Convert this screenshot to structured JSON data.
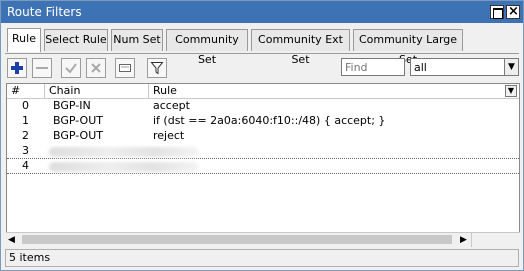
{
  "window": {
    "title": "Route Filters",
    "colors": {
      "titlebar": "#3d73b5",
      "add_icon": "#1a3fa8"
    }
  },
  "tabs": [
    {
      "label": "Rule",
      "active": true
    },
    {
      "label": "Select Rule"
    },
    {
      "label": "Num Set"
    },
    {
      "label": "Community Set"
    },
    {
      "label": "Community Ext Set"
    },
    {
      "label": "Community Large Set"
    }
  ],
  "toolbar": {
    "icons": [
      "add-icon",
      "remove-icon",
      "enable-icon",
      "disable-icon",
      "comment-icon",
      "filter-icon"
    ],
    "find_placeholder": "Find",
    "filter_select_value": "all"
  },
  "table": {
    "columns": [
      "#",
      "Chain",
      "Rule"
    ],
    "rows": [
      {
        "num": "0",
        "chain": "BGP-IN",
        "rule": "accept"
      },
      {
        "num": "1",
        "chain": "BGP-OUT",
        "rule": "if (dst == 2a0a:6040:f10::/48) { accept; }"
      },
      {
        "num": "2",
        "chain": "BGP-OUT",
        "rule": "reject"
      },
      {
        "num": "3",
        "chain": "",
        "rule": ""
      },
      {
        "num": "4",
        "chain": "",
        "rule": ""
      }
    ]
  },
  "status": {
    "items_count": "5 items"
  }
}
